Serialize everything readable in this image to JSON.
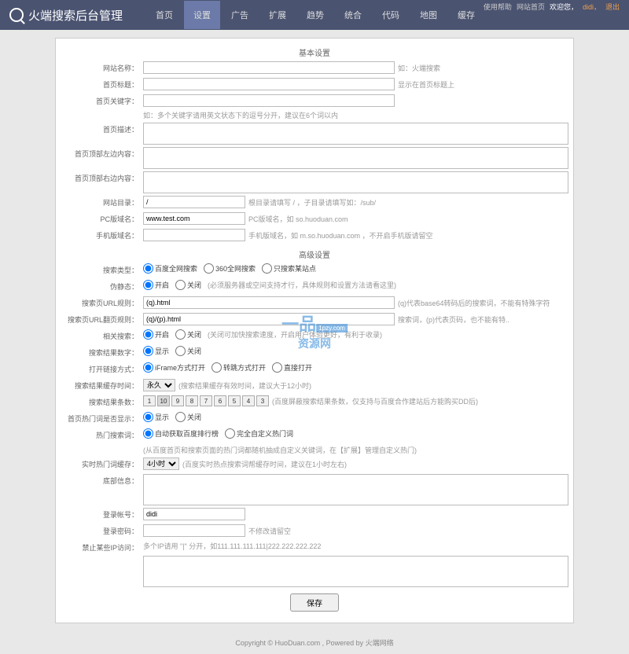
{
  "header": {
    "title": "火端搜索后台管理",
    "topbar": {
      "help": "使用帮助",
      "home": "网站首页",
      "welcome": "欢迎您，",
      "user": "didi，",
      "logout": "退出"
    },
    "nav": [
      "首页",
      "设置",
      "广告",
      "扩展",
      "趋势",
      "统合",
      "代码",
      "地图",
      "缓存"
    ]
  },
  "sections": {
    "basic": "基本设置",
    "advanced": "高级设置"
  },
  "labels": {
    "site_name": "网站名称：",
    "home_title": "首页标题：",
    "home_keywords": "首页关键字：",
    "home_desc": "首页描述：",
    "top_left": "首页顶部左边内容：",
    "top_right": "首页顶部右边内容：",
    "site_dir": "网站目录：",
    "pc_domain": "PC版域名：",
    "mobile_domain": "手机版域名：",
    "search_type": "搜索类型：",
    "pseudo_static": "伪静态：",
    "url_rule": "搜索页URL规则：",
    "url_rule2": "搜索页URL翻页规则：",
    "related": "相关搜索：",
    "result_count": "搜索结果数字：",
    "open_mode": "打开链接方式：",
    "cache_time": "搜索结果缓存时间：",
    "result_per": "搜索结果条数：",
    "hot_display": "首页热门词是否显示：",
    "hot_source": "热门搜索词：",
    "hot_cache": "实时热门词缓存：",
    "bottom_info": "底部信息：",
    "login_user": "登录帐号：",
    "login_pass": "登录密码：",
    "ban_ip": "禁止某些IP访问："
  },
  "values": {
    "site_dir": "/",
    "pc_domain": "www.test.com",
    "url_rule": "(q).html",
    "url_rule2": "(q)/(p).html",
    "login_user": "didi"
  },
  "hints": {
    "site_name": "如：火端搜索",
    "home_title": "显示在首页标题上",
    "home_keywords": "如：多个关键字请用英文状态下的逗号分开，建议在6个词以内",
    "site_dir": "根目录请填写 / ，子目录请填写如：/sub/",
    "pc_domain": "PC版域名，如 so.huoduan.com",
    "mobile_domain": "手机版域名，如 m.so.huoduan.com ，不开启手机版请留空",
    "pseudo": "(必须服务器或空间支持才行，具体规则和设置方法请看这里)",
    "url_rule": "(q)代表base64转码后的搜索词，不能有特殊字符",
    "url_rule2": "搜索词，(p)代表页码，也不能有特..",
    "related": "(关闭可加快搜索速度，开启用户体验更好，有利于收录)",
    "cache": "(搜索结果缓存有效时间，建议大于12小时)",
    "result_per": "(百度屏蔽搜索结果条数，仅支持与百度合作建站后方能购买DD后)",
    "hot_source": "(从百度首页和搜索页面的热门词都随机抽成自定义关键词，在【扩展】管理自定义热门)",
    "hot_cache": "(百度实时热点搜索词帮缓存时间，建议在1小时左右)",
    "login_pass": "不修改请留空",
    "ban_ip": "多个IP请用 \"|\" 分开，如111.111.111.111|222.222.222.222"
  },
  "radios": {
    "search_type": [
      "百度全网搜索",
      "360全网搜索",
      "只搜索某站点"
    ],
    "onoff": [
      "开启",
      "关闭"
    ],
    "showhide": [
      "显示",
      "关闭"
    ],
    "open_mode": [
      "iFrame方式打开",
      "转跳方式打开",
      "直接打开"
    ],
    "hot_source": [
      "自动获取百度排行榜",
      "完全自定义热门词"
    ]
  },
  "selects": {
    "cache_time": "永久",
    "hot_cache": "4小时"
  },
  "nums": [
    "1",
    "10",
    "9",
    "8",
    "7",
    "6",
    "5",
    "4",
    "3"
  ],
  "save": "保存",
  "footer": {
    "copyright": "Copyright © ",
    "link": "HuoDuan.com",
    "powered": " , Powered by 火端网络"
  },
  "watermark": {
    "t1": "一品",
    "t2": "资源网",
    "t3": "1pzy.com"
  }
}
